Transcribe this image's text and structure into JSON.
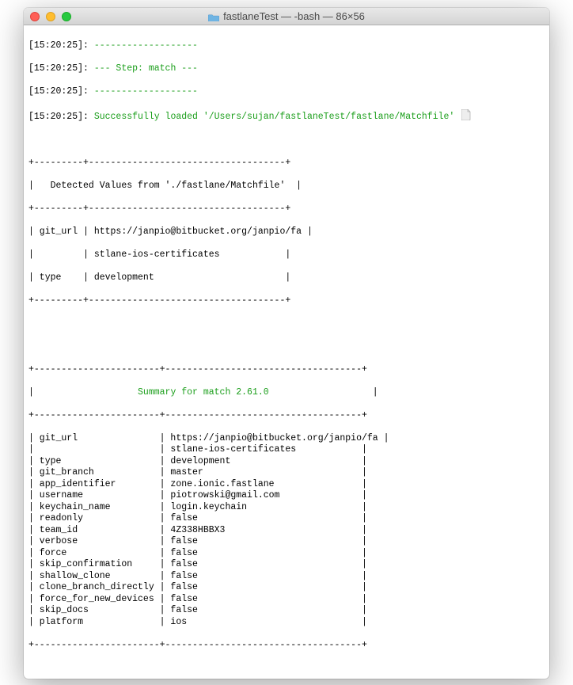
{
  "window": {
    "title": "fastlaneTest — -bash — 86×56"
  },
  "lines": {
    "ts": "[15:20:25]:",
    "dash1": "-------------------",
    "step": "--- Step: match ---",
    "dash2": "-------------------",
    "loaded": "Successfully loaded '/Users/sujan/fastlaneTest/fastlane/Matchfile'"
  },
  "table1": {
    "border": "+---------+------------------------------------+",
    "title": "|   Detected Values from './fastlane/Matchfile'  |",
    "sep": "+---------+------------------------------------+",
    "r1": "| git_url | https://janpio@bitbucket.org/janpio/fa |",
    "r2": "|         | stlane-ios-certificates            |",
    "r3": "| type    | development                        |",
    "end": "+---------+------------------------------------+"
  },
  "table2": {
    "border": "+-----------------------+------------------------------------+",
    "titleL": "|                   ",
    "titleC": "Summary for match 2.61.0",
    "titleR": "                   |",
    "sep": "+-----------------------+------------------------------------+",
    "rows": [
      "| git_url               | https://janpio@bitbucket.org/janpio/fa |",
      "|                       | stlane-ios-certificates            |",
      "| type                  | development                        |",
      "| git_branch            | master                             |",
      "| app_identifier        | zone.ionic.fastlane                |",
      "| username              | piotrowski@gmail.com               |",
      "| keychain_name         | login.keychain                     |",
      "| readonly              | false                              |",
      "| team_id               | 4Z338HBBX3                         |",
      "| verbose               | false                              |",
      "| force                 | false                              |",
      "| skip_confirmation     | false                              |",
      "| shallow_clone         | false                              |",
      "| clone_branch_directly | false                              |",
      "| force_for_new_devices | false                              |",
      "| skip_docs             | false                              |",
      "| platform              | ios                                |"
    ],
    "end": "+-----------------------+------------------------------------+"
  },
  "chart_data": {
    "type": "table",
    "title": "Summary for match 2.61.0",
    "detected_values": {
      "git_url": "https://janpio@bitbucket.org/janpio/fastlane-ios-certificates",
      "type": "development"
    },
    "summary": {
      "git_url": "https://janpio@bitbucket.org/janpio/fastlane-ios-certificates",
      "type": "development",
      "git_branch": "master",
      "app_identifier": "zone.ionic.fastlane",
      "username": "piotrowski@gmail.com",
      "keychain_name": "login.keychain",
      "readonly": "false",
      "team_id": "4Z338HBBX3",
      "verbose": "false",
      "force": "false",
      "skip_confirmation": "false",
      "shallow_clone": "false",
      "clone_branch_directly": "false",
      "force_for_new_devices": "false",
      "skip_docs": "false",
      "platform": "ios"
    }
  }
}
